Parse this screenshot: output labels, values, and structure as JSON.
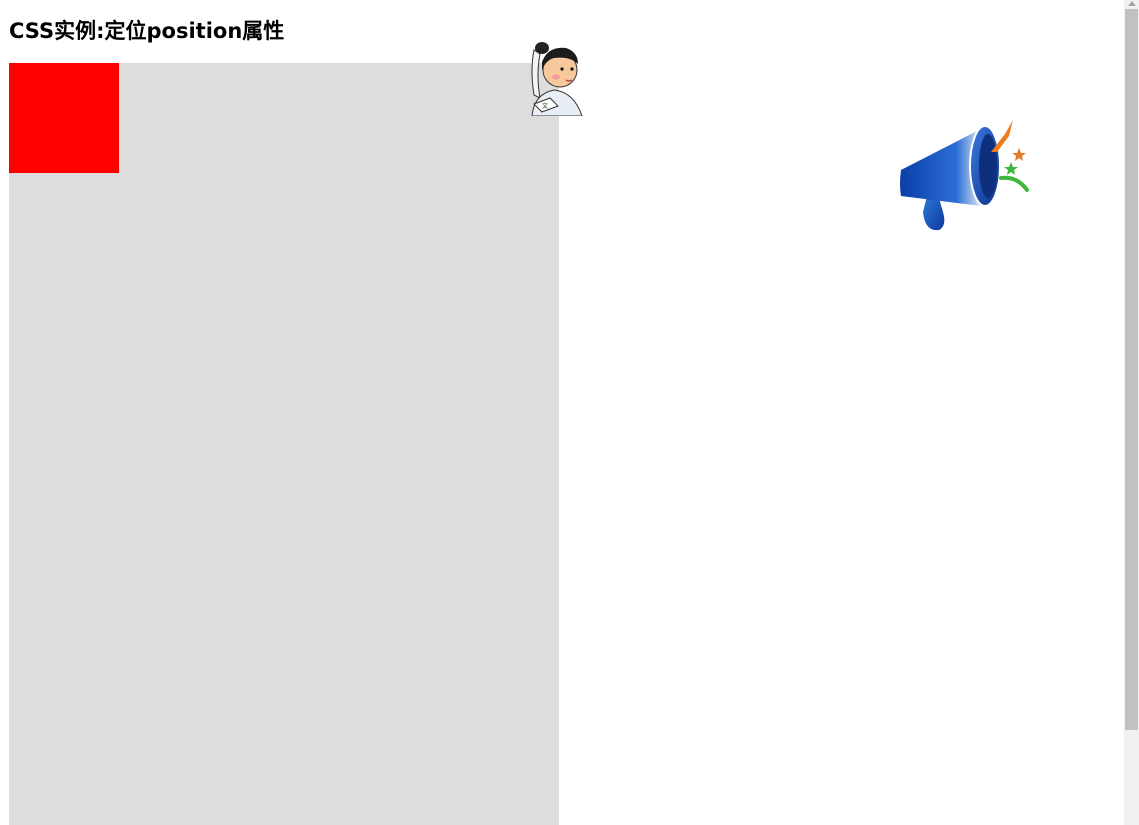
{
  "page": {
    "title": "CSS实例:定位position属性"
  },
  "boxes": {
    "gray_box_color": "#dddddd",
    "red_box_color": "#ff0000"
  },
  "images": {
    "character": "cartoon-scholar-figure",
    "megaphone": "megaphone-icon"
  },
  "colors": {
    "megaphone_blue": "#1a4fb5",
    "burst_orange": "#f07a1c",
    "burst_green": "#3cb83c"
  }
}
